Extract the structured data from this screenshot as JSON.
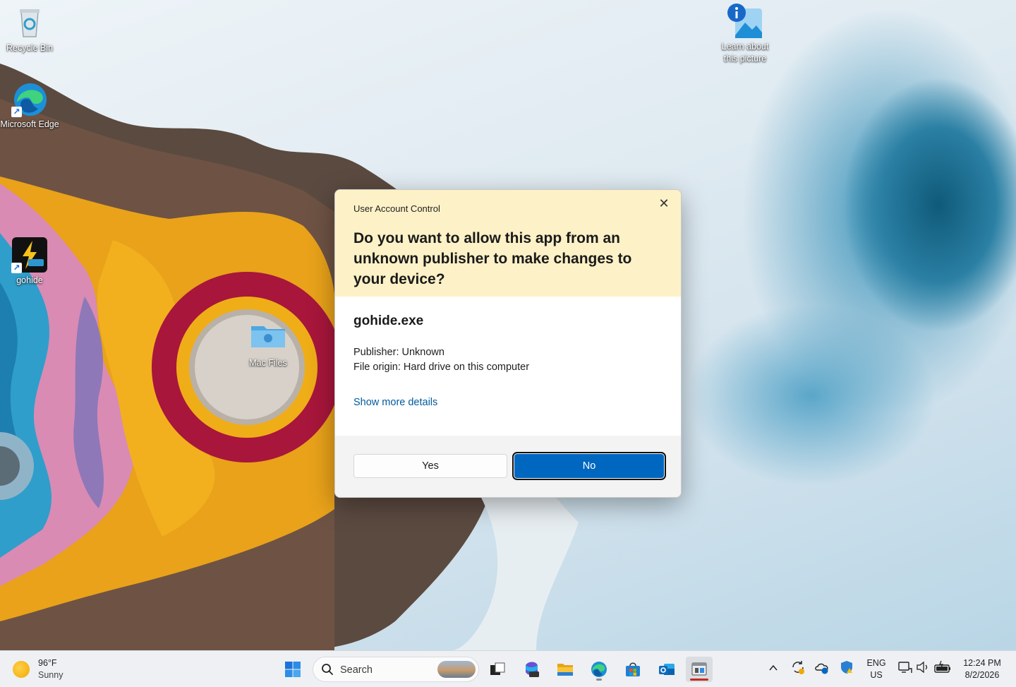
{
  "desktop": {
    "icons": {
      "recycle_bin": "Recycle Bin",
      "edge": "Microsoft Edge",
      "gohide": "gohide",
      "mac_files": "Mac Files",
      "learn_picture": "Learn about this picture"
    }
  },
  "uac": {
    "caption": "User Account Control",
    "question": "Do you want to allow this app from an unknown publisher to make changes to your device?",
    "app_name": "gohide.exe",
    "publisher": "Publisher: Unknown",
    "file_origin": "File origin: Hard drive on this computer",
    "show_more": "Show more details",
    "yes_label": "Yes",
    "no_label": "No",
    "close_glyph": "✕",
    "accent_color": "#0067c0",
    "header_color": "#fdf1c7"
  },
  "taskbar": {
    "weather": {
      "temp": "96°F",
      "condition": "Sunny"
    },
    "search_placeholder": "Search",
    "apps": [
      "start-icon",
      "task-view-icon",
      "microsoft-365-icon",
      "file-explorer-icon",
      "edge-icon",
      "microsoft-store-icon",
      "outlook-icon",
      "gohide-app-icon"
    ],
    "tray_icons": [
      "chevron-up-icon",
      "sync-icon",
      "onedrive-icon",
      "defender-icon",
      "network-icon",
      "speaker-icon",
      "battery-icon"
    ],
    "lang_line1": "ENG",
    "lang_line2": "US",
    "time": "12:24 PM",
    "date": "8/2/2026"
  }
}
